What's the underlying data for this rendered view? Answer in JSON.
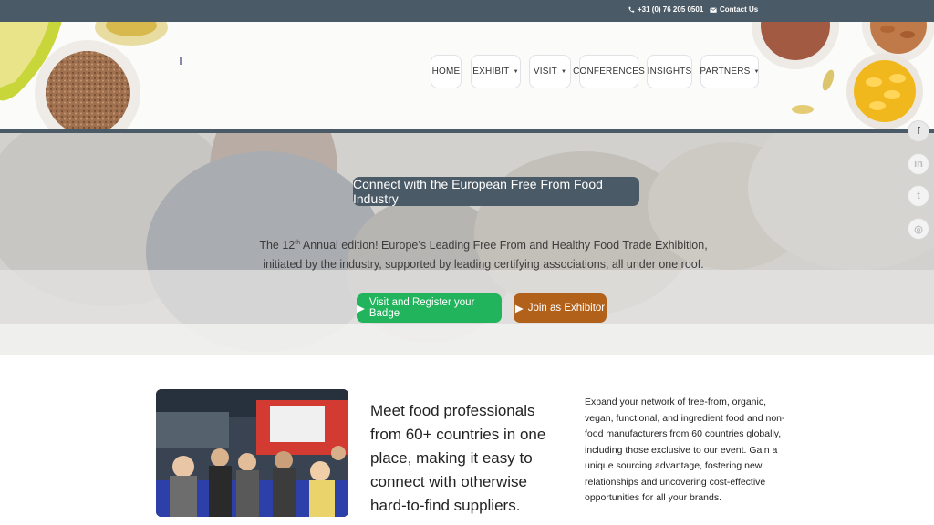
{
  "topbar": {
    "phone": "+31 (0) 76 205 0501",
    "contact": "Contact Us"
  },
  "nav": {
    "items": [
      {
        "label": "HOME",
        "has_dropdown": false
      },
      {
        "label": "EXHIBIT",
        "has_dropdown": true
      },
      {
        "label": "VISIT",
        "has_dropdown": true
      },
      {
        "label": "CONFERENCES",
        "has_dropdown": false
      },
      {
        "label": "INSIGHTS",
        "has_dropdown": false
      },
      {
        "label": "PARTNERS",
        "has_dropdown": true
      }
    ]
  },
  "hero": {
    "title": "Connect with the European Free From Food Industry",
    "text_pre": "The 12",
    "text_sup": "th",
    "text_post": " Annual edition! Europe’s Leading Free From and Healthy Food Trade Exhibition, initiated by the industry, supported by leading certifying associations, all under one roof.",
    "visit_button": "Visit and Register your Badge",
    "exhibit_button": "Join as Exhibitor"
  },
  "social": {
    "facebook": "f",
    "linkedin": "in",
    "twitter": "t",
    "instagram": "◎"
  },
  "content": {
    "lead": "Meet food professionals from 60+ countries in one place, making it easy to connect with otherwise hard-to-find suppliers.",
    "description": "Expand your network of free-from, organic, vegan, functional, and ingredient food and non-food manufacturers from 60 countries globally, including those exclusive to our event. Gain a unique sourcing advantage, fostering new relationships and uncovering cost-effective opportunities for all your brands."
  },
  "colors": {
    "topbar": "#4a5a66",
    "visit_button": "#21b45c",
    "exhibit_button": "#b2611b"
  },
  "icons": [
    "phone-icon",
    "mail-icon",
    "caret-down-icon",
    "play-icon",
    "facebook-icon",
    "linkedin-icon",
    "twitter-icon",
    "instagram-icon"
  ]
}
